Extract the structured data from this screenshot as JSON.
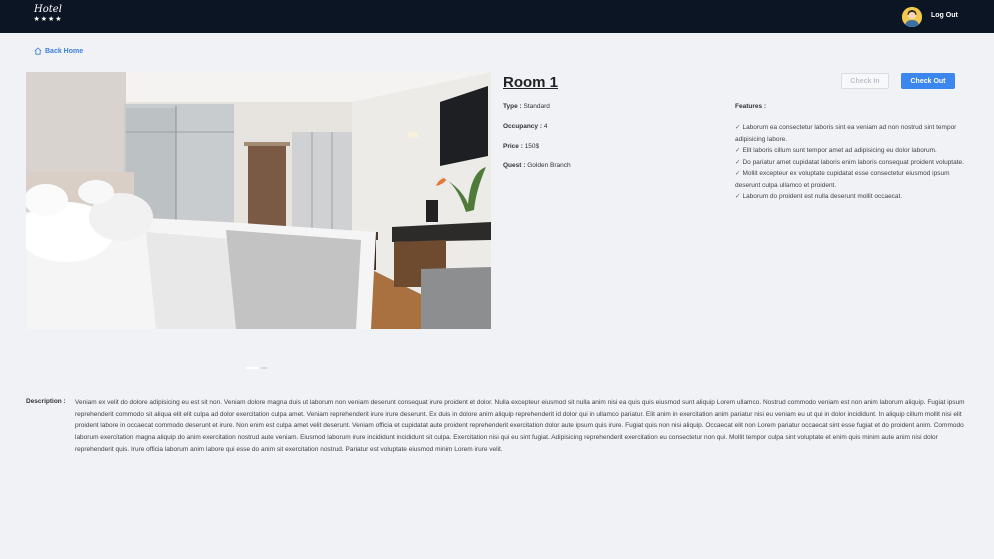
{
  "header": {
    "logo_text": "Hotel",
    "logo_stars": "★★★★",
    "logout_label": "Log Out"
  },
  "nav": {
    "back_label": "Back Home"
  },
  "room": {
    "title": "Room 1",
    "check_in_label": "Check In",
    "check_out_label": "Check Out",
    "type_label": "Type :",
    "type_value": "Standard",
    "occupancy_label": "Occupancy :",
    "occupancy_value": "4",
    "price_label": "Price :",
    "price_value": "150$",
    "guest_label": "Quest :",
    "guest_value": "Golden Branch",
    "features_label": "Features :",
    "features": [
      "Laborum ea consectetur laboris sint ea veniam ad non nostrud sint tempor adipisicing labore.",
      "Elit laboris cillum sunt tempor amet ad adipisicing eu dolor laborum.",
      "Do pariatur amet cupidatat laboris enim laboris consequat proident voluptate.",
      "Mollit excepteur ex voluptate cupidatat esse consectetur eiusmod ipsum deserunt culpa ullamco et proident.",
      "Laborum do proident est nulla deserunt mollit occaecat."
    ]
  },
  "description": {
    "label": "Description :",
    "text": "Veniam ex velit do dolore adipisicing eu est sit non. Veniam dolore magna duis ut laborum non veniam deserunt consequat irure proident et dolor. Nulla excepteur eiusmod sit nulla anim nisi ea quis quis eiusmod sunt aliquip Lorem ullamco. Nostrud commodo veniam est non anim laborum aliquip. Fugiat ipsum reprehenderit commodo sit aliqua elit elit culpa ad dolor exercitation culpa amet. Veniam reprehenderit irure irure deserunt. Ex duis in dolore anim aliquip reprehenderit id dolor qui in ullamco pariatur. Elit anim in exercitation anim pariatur nisi eu veniam eu ut qui in dolor incididunt. In aliquip cillum mollit nisi elit proident labore in occaecat commodo deserunt et irure. Non enim est culpa amet velit deserunt. Veniam officia et cupidatat aute proident reprehenderit exercitation dolor aute ipsum quis irure. Fugiat quis non nisi aliquip. Occaecat elit non Lorem pariatur occaecat sint esse fugiat et do proident anim. Commodo laborum exercitation magna aliquip do anim exercitation nostrud aute veniam. Eiusmod laborum irure incididunt incididunt sit culpa. Exercitation nisi qui eu sint fugiat. Adipisicing reprehenderit exercitation eu consectetur non qui. Mollit tempor culpa sint voluptate et enim quis minim aute anim nisi dolor reprehenderit quis. Irure officia laborum anim labore qui esse do anim sit exercitation nostrud. Pariatur est voluptate eiusmod minim Lorem irure velit."
  },
  "carousel": {
    "slide_count": 3,
    "active_index": 0
  },
  "colors": {
    "topbar": "#0b1523",
    "accent": "#3c86f0",
    "background": "#f1f2f6"
  },
  "icons": {
    "home": "home-icon",
    "check": "check-icon",
    "avatar": "user-avatar"
  }
}
